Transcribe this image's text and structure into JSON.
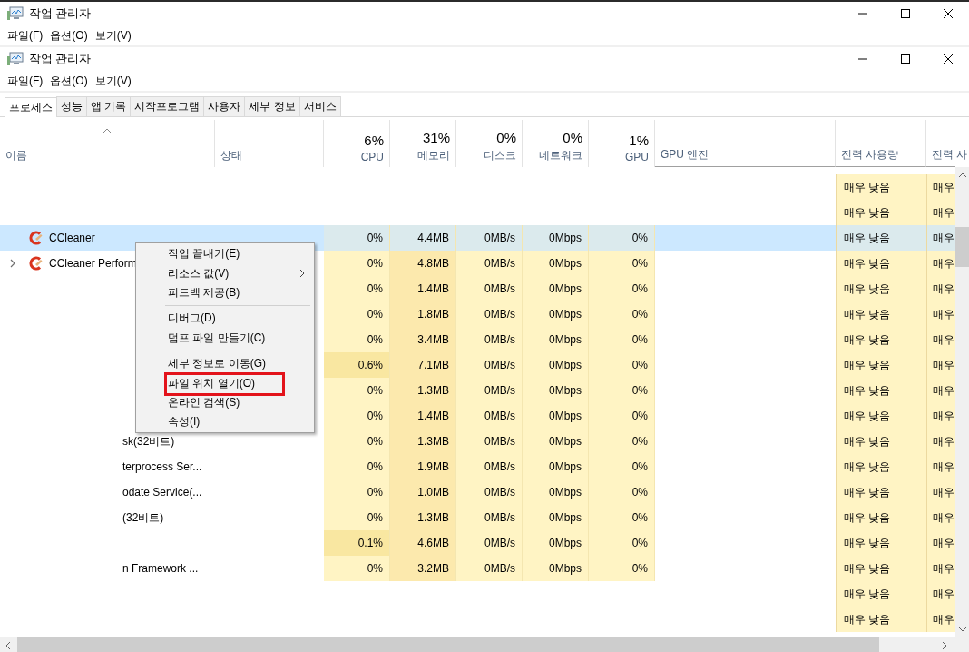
{
  "outer_window": {
    "title": "작업 관리자",
    "menu": [
      "파일(F)",
      "옵션(O)",
      "보기(V)"
    ]
  },
  "window": {
    "title": "작업 관리자",
    "menu": [
      "파일(F)",
      "옵션(O)",
      "보기(V)"
    ]
  },
  "tabs": [
    {
      "label": "프로세스",
      "selected": true
    },
    {
      "label": "성능",
      "selected": false
    },
    {
      "label": "앱 기록",
      "selected": false
    },
    {
      "label": "시작프로그램",
      "selected": false
    },
    {
      "label": "사용자",
      "selected": false
    },
    {
      "label": "세부 정보",
      "selected": false
    },
    {
      "label": "서비스",
      "selected": false
    }
  ],
  "columns": [
    {
      "label": "이름",
      "sorted": true
    },
    {
      "label": "상태"
    },
    {
      "label": "CPU",
      "total": "6%"
    },
    {
      "label": "메모리",
      "total": "31%"
    },
    {
      "label": "디스크",
      "total": "0%"
    },
    {
      "label": "네트워크",
      "total": "0%"
    },
    {
      "label": "GPU",
      "total": "1%"
    },
    {
      "label": "GPU 엔진"
    },
    {
      "label": "전력 사용량"
    },
    {
      "label": "전력 사"
    }
  ],
  "rows": [
    {
      "selected": false,
      "power": "매우 낮음",
      "power_trend": "매우"
    },
    {
      "selected": false,
      "power": "매우 낮음",
      "power_trend": "매우"
    },
    {
      "selected": true,
      "kind": "app",
      "name": "CCleaner",
      "values": [
        "0%",
        "4.4MB",
        "0MB/s",
        "0Mbps",
        "0%"
      ],
      "power": "매우 낮음",
      "power_trend": "매우"
    },
    {
      "selected": false,
      "kind": "app",
      "name": "CCleaner Perform",
      "expanded": false,
      "values": [
        "0%",
        "4.8MB",
        "0MB/s",
        "0Mbps",
        "0%"
      ],
      "power": "매우 낮음",
      "power_trend": "매우"
    },
    {
      "selected": false,
      "values": [
        "0%",
        "1.4MB",
        "0MB/s",
        "0Mbps",
        "0%"
      ],
      "power": "매우 낮음",
      "power_trend": "매우"
    },
    {
      "selected": false,
      "values": [
        "0%",
        "1.8MB",
        "0MB/s",
        "0Mbps",
        "0%"
      ],
      "power": "매우 낮음",
      "power_trend": "매우"
    },
    {
      "selected": false,
      "values": [
        "0%",
        "3.4MB",
        "0MB/s",
        "0Mbps",
        "0%"
      ],
      "power": "매우 낮음",
      "power_trend": "매우"
    },
    {
      "selected": false,
      "cpu_hot": true,
      "values": [
        "0.6%",
        "7.1MB",
        "0MB/s",
        "0Mbps",
        "0%"
      ],
      "power": "매우 낮음",
      "power_trend": "매우"
    },
    {
      "selected": false,
      "values": [
        "0%",
        "1.3MB",
        "0MB/s",
        "0Mbps",
        "0%"
      ],
      "power": "매우 낮음",
      "power_trend": "매우"
    },
    {
      "selected": false,
      "values": [
        "0%",
        "1.4MB",
        "0MB/s",
        "0Mbps",
        "0%"
      ],
      "power": "매우 낮음",
      "power_trend": "매우"
    },
    {
      "selected": false,
      "kind": "fragment",
      "name": "sk(32비트)",
      "values": [
        "0%",
        "1.3MB",
        "0MB/s",
        "0Mbps",
        "0%"
      ],
      "power": "매우 낮음",
      "power_trend": "매우"
    },
    {
      "selected": false,
      "kind": "fragment",
      "name": "terprocess Ser...",
      "values": [
        "0%",
        "1.9MB",
        "0MB/s",
        "0Mbps",
        "0%"
      ],
      "power": "매우 낮음",
      "power_trend": "매우"
    },
    {
      "selected": false,
      "kind": "fragment",
      "name": "odate Service(...",
      "values": [
        "0%",
        "1.0MB",
        "0MB/s",
        "0Mbps",
        "0%"
      ],
      "power": "매우 낮음",
      "power_trend": "매우"
    },
    {
      "selected": false,
      "kind": "fragment",
      "name": "(32비트)",
      "values": [
        "0%",
        "1.3MB",
        "0MB/s",
        "0Mbps",
        "0%"
      ],
      "power": "매우 낮음",
      "power_trend": "매우"
    },
    {
      "selected": false,
      "cpu_hot": true,
      "values": [
        "0.1%",
        "4.6MB",
        "0MB/s",
        "0Mbps",
        "0%"
      ],
      "power": "매우 낮음",
      "power_trend": "매우"
    },
    {
      "selected": false,
      "kind": "fragment",
      "name": "n Framework ...",
      "values": [
        "0%",
        "3.2MB",
        "0MB/s",
        "0Mbps",
        "0%"
      ],
      "power": "매우 낮음",
      "power_trend": "매우"
    },
    {
      "selected": false,
      "power": "매우 낮음",
      "power_trend": "매우"
    },
    {
      "selected": false,
      "power": "매우 낮음",
      "power_trend": "매우"
    }
  ],
  "context_menu": [
    {
      "kind": "item",
      "label": "작업 끝내기(E)"
    },
    {
      "kind": "item",
      "label": "리소스 값(V)",
      "submenu": true
    },
    {
      "kind": "item",
      "label": "피드백 제공(B)"
    },
    {
      "kind": "separator"
    },
    {
      "kind": "item",
      "label": "디버그(D)"
    },
    {
      "kind": "item",
      "label": "덤프 파일 만들기(C)"
    },
    {
      "kind": "separator"
    },
    {
      "kind": "item",
      "label": "세부 정보로 이동(G)"
    },
    {
      "kind": "item",
      "label": "파일 위치 열기(O)",
      "highlighted": true
    },
    {
      "kind": "item",
      "label": "온라인 검색(S)"
    },
    {
      "kind": "item",
      "label": "속성(I)"
    }
  ]
}
